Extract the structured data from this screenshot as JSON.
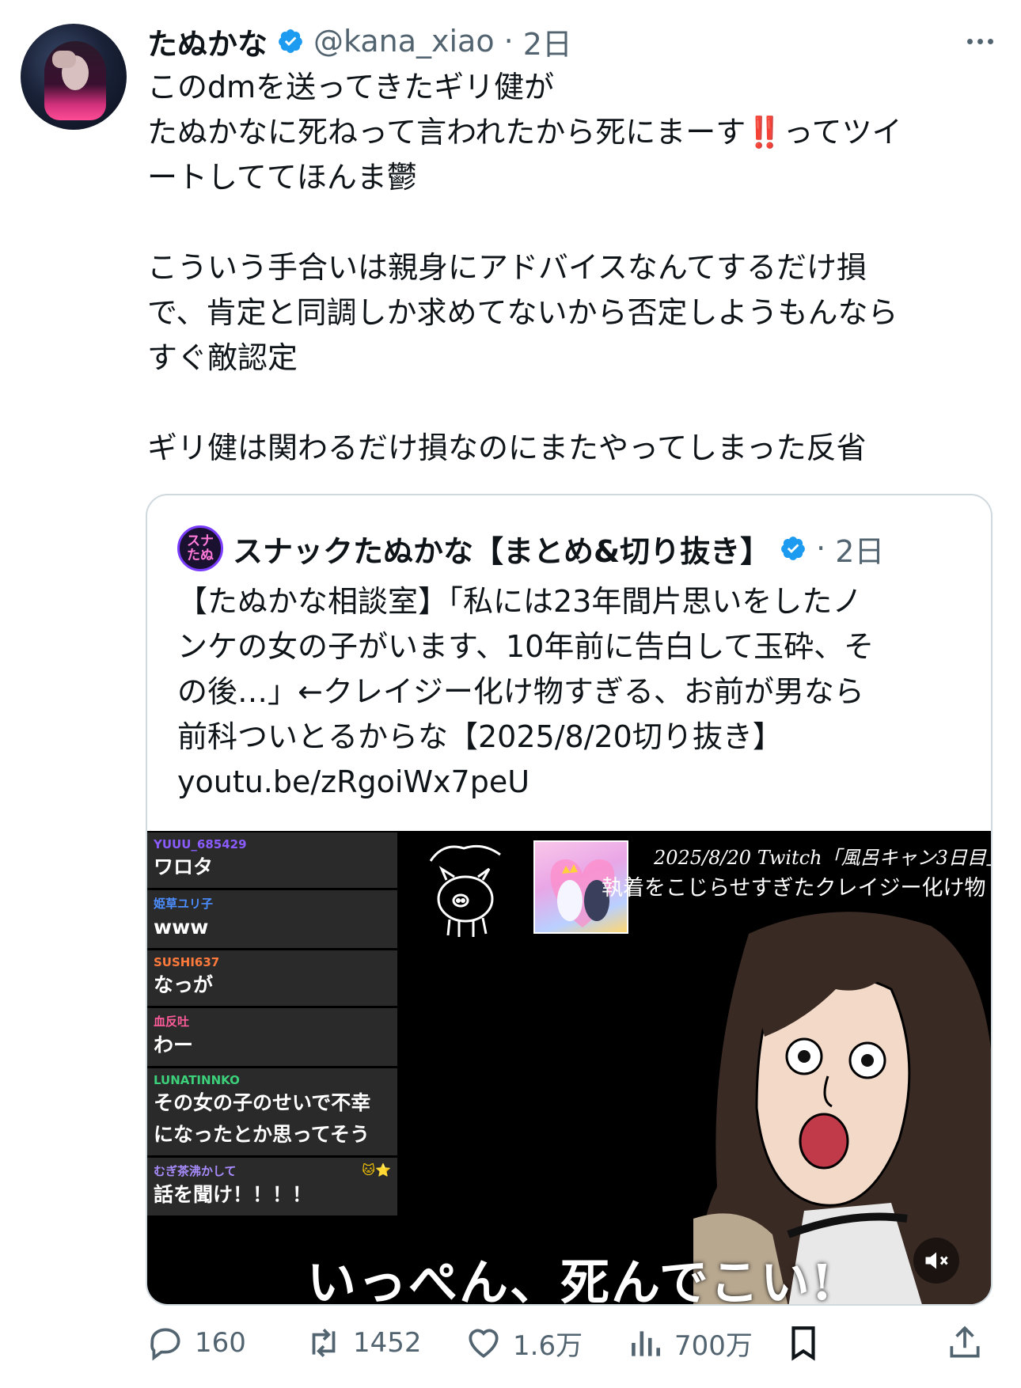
{
  "author": {
    "display_name": "たぬかな",
    "handle": "@kana_xiao",
    "separator": "·",
    "time": "2日"
  },
  "tweet": {
    "line1": "このdmを送ってきたギリ健が",
    "line2_before": "たぬかなに死ねって言われたから死にまーす",
    "line2_emoji": "‼️",
    "line2_after": "ってツイ",
    "line3": "ートしててほんま鬱",
    "para2": "こういう手合いは親身にアドバイスなんてするだけ損\nで、肯定と同調しか求めてないから否定しようもんなら\nすぐ敵認定",
    "para3": "ギリ健は関わるだけ損なのにまたやってしまった反省"
  },
  "quote": {
    "avatar_text_top": "スナ",
    "avatar_text_bottom": "たぬ",
    "display_name": "スナックたぬかな【まとめ&切り抜き】",
    "separator": "·",
    "time": "2日",
    "text": "【たぬかな相談室】「私には23年間片思いをしたノ\nンケの女の子がいます、10年前に告白して玉砕、そ\nの後…」←クレイジー化け物すぎる、お前が男なら\n前科ついとるからな【2025/8/20切り抜き】\nyoutu.be/zRgoiWx7peU"
  },
  "video": {
    "stream_info": "2025/8/20 Twitch「風呂キャン3日目」",
    "caption": "執着をこじらせすぎたクレイジー化け物",
    "subtitle": "いっぺん、死んでこい!",
    "chat": [
      {
        "user": "YUUU_685429",
        "msg": "ワロタ",
        "color": "#8a5cff"
      },
      {
        "user": "姫草ユリ子",
        "msg": "www",
        "color": "#4c8dff"
      },
      {
        "user": "SUSHI637",
        "msg": "なっが",
        "color": "#ff7a3c"
      },
      {
        "user": "血反吐",
        "msg": "わー",
        "color": "#ff5c9a"
      },
      {
        "user": "LUNATINNKO",
        "msg": "その女の子のせいで不幸\nになったとか思ってそう",
        "color": "#3cd07a"
      },
      {
        "user": "むぎ茶沸かして",
        "msg": "話を聞け！！！！",
        "color": "#a88cff",
        "badges": "🐱⭐"
      }
    ]
  },
  "actions": {
    "replies": "160",
    "reposts": "1452",
    "likes": "1.6万",
    "views": "700万"
  },
  "colors": {
    "verified": "#1d9bf0",
    "muted_text": "#536471",
    "border": "#cfd9de",
    "emphasis": "#e0202e"
  },
  "icons": [
    "verified-badge-icon",
    "more-icon",
    "reply-icon",
    "repost-icon",
    "like-icon",
    "views-icon",
    "bookmark-icon",
    "share-icon",
    "mute-icon"
  ]
}
